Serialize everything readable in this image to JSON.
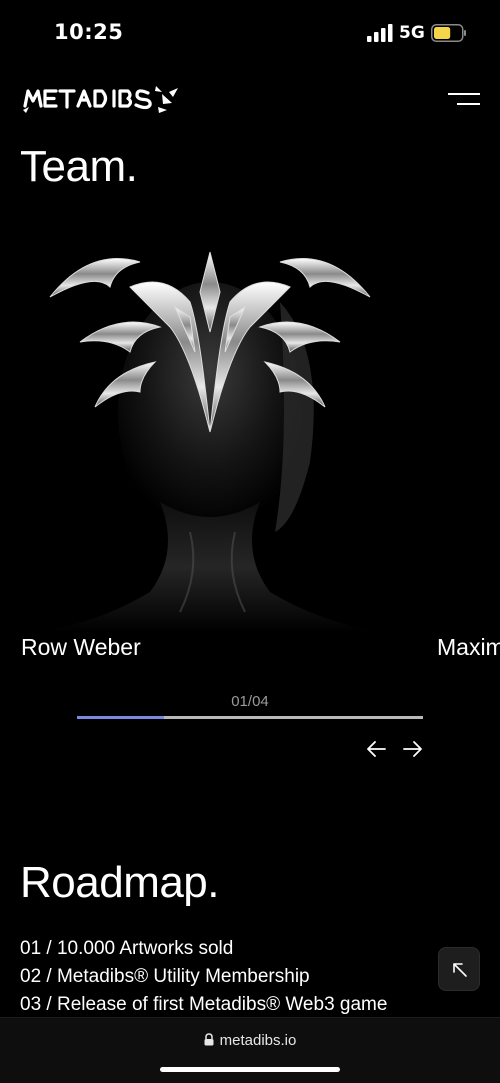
{
  "status_bar": {
    "time": "10:25",
    "network": "5G",
    "battery_level": 0.6,
    "battery_color": "#f5d64a",
    "icons": [
      "signal-bars-icon",
      "battery-icon"
    ]
  },
  "header": {
    "logo_text": "METADIBS",
    "menu_icon": "hamburger-icon"
  },
  "team": {
    "title": "Team.",
    "members": [
      "Row Weber",
      "Maxim"
    ],
    "counter": "01/04",
    "progress": 0.25,
    "accent_color": "#7a8ae0",
    "prev_icon": "arrow-left-icon",
    "next_icon": "arrow-right-icon"
  },
  "roadmap": {
    "title": "Roadmap.",
    "items": [
      "01 / 10.000 Artworks sold",
      "02 / Metadibs® Utility Membership",
      "03 / Release of first Metadibs® Web3 game"
    ]
  },
  "scroll_top_icon": "arrow-up-left-icon",
  "browser": {
    "url": "metadibs.io",
    "lock_icon": "lock-icon"
  }
}
